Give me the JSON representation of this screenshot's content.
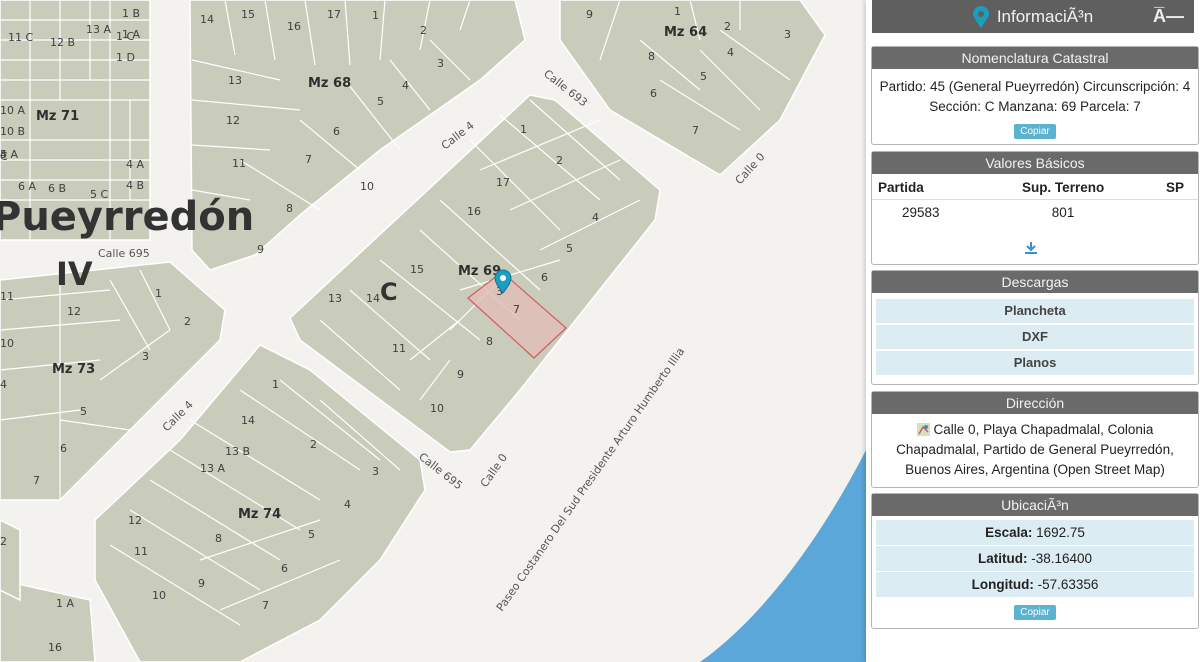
{
  "map": {
    "town_name": "Pueyrredón",
    "circ_label": "IV",
    "seccion_label": "C",
    "manzanas": [
      "Mz 64",
      "Mz 68",
      "Mz 71",
      "Mz 69",
      "Mz 73",
      "Mz 74"
    ],
    "streets": [
      "Calle 693",
      "Calle 4",
      "Calle 0",
      "Calle 695",
      "Calle 4",
      "Calle 695",
      "Calle 0",
      "Paseo Costanero Del Sud Presidente Arturo Humberto Illia"
    ],
    "mz69_lots": [
      "1",
      "2",
      "17",
      "16",
      "4",
      "15",
      "5",
      "14",
      "6",
      "13",
      "7",
      "8",
      "11",
      "9",
      "10",
      "3"
    ],
    "mz68_lots": [
      "14",
      "15",
      "16",
      "17",
      "1",
      "2",
      "3",
      "13",
      "4",
      "12",
      "5",
      "11",
      "6",
      "7",
      "8",
      "9",
      "10"
    ],
    "mz64_lots": [
      "9",
      "1",
      "2",
      "3",
      "4",
      "5",
      "6",
      "7",
      "8"
    ],
    "mz71_lots": [
      "1 B",
      "1 A",
      "11 C",
      "13 A",
      "1 C",
      "12 B",
      "1 D",
      "10 A",
      "10 B",
      "5 A",
      "6 B",
      "5 C",
      "4 A",
      "4 B",
      "4",
      "6 A",
      "C"
    ],
    "mz73_lots": [
      "11",
      "12",
      "1",
      "2",
      "10",
      "3",
      "4",
      "5",
      "6",
      "7"
    ],
    "mz74_lots": [
      "1",
      "14",
      "13 B",
      "2",
      "13 A",
      "3",
      "4",
      "12",
      "5",
      "11",
      "6",
      "10",
      "9",
      "7",
      "8"
    ],
    "misc_lots": [
      "1 A",
      "16",
      "2"
    ],
    "colors": {
      "block": "#c9cbbb",
      "selected": "#e0bfb7",
      "water": "#5ba7d9",
      "marker": "#1a9fc0"
    }
  },
  "panel": {
    "header": {
      "title": "InformaciÃ³n",
      "info_icon": "map-marker-icon",
      "accessibility_icon": "text-size-icon",
      "accessibility_glyph": "A̅—"
    },
    "nomenclatura": {
      "title": "Nomenclatura Catastral",
      "text": "Partido: 45 (General Pueyrredón) Circunscripción: 4 Sección: C Manzana: 69 Parcela: 7",
      "copy_label": "Copiar"
    },
    "valores": {
      "title": "Valores Básicos",
      "headers": [
        "Partida",
        "Sup. Terreno",
        "SP"
      ],
      "row": [
        "29583",
        "801",
        ""
      ],
      "download_icon": "download-icon"
    },
    "descargas": {
      "title": "Descargas",
      "items": [
        "Plancheta",
        "DXF",
        "Planos"
      ]
    },
    "direccion": {
      "title": "Dirección",
      "map_icon": "map-icon",
      "text": "Calle 0, Playa Chapadmalal, Colonia Chapadmalal, Partido de General Pueyrredón, Buenos Aires, Argentina (Open Street Map)"
    },
    "ubicacion": {
      "title": "UbicaciÃ³n",
      "escala_label": "Escala:",
      "escala": "1692.75",
      "latitud_label": "Latitud:",
      "latitud": "-38.16400",
      "longitud_label": "Longitud:",
      "longitud": "-57.63356",
      "copy_label": "Copiar"
    }
  }
}
